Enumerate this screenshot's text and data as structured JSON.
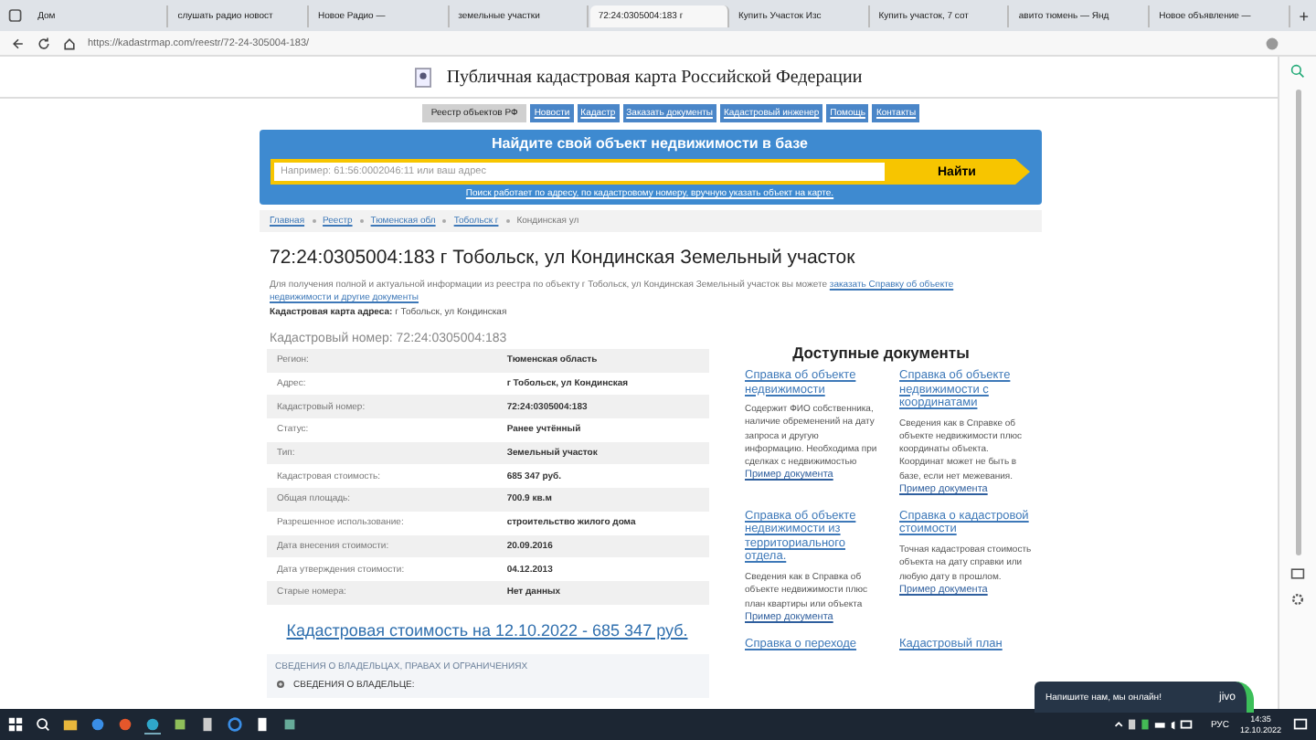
{
  "browser": {
    "tabs": [
      {
        "label": "Дом",
        "selected": false
      },
      {
        "label": "слушать радио новост",
        "selected": false
      },
      {
        "label": "Новое Радио —",
        "selected": false
      },
      {
        "label": "земельные участки",
        "selected": false
      },
      {
        "label": "72:24:0305004:183 г",
        "selected": true
      },
      {
        "label": "Купить Участок Изс",
        "selected": false
      },
      {
        "label": "Купить участок, 7 сот",
        "selected": false
      },
      {
        "label": "авито тюмень — Янд",
        "selected": false
      },
      {
        "label": "Новое объявление —",
        "selected": false
      }
    ],
    "new_tab": "+",
    "url": "https://kadastrmap.com/reestr/72-24-305004-183/"
  },
  "site": {
    "title": "Публичная кадастровая карта Российской Федерации",
    "nav": [
      {
        "label": "Реестр объектов РФ",
        "selected": true
      },
      {
        "label": "Новости",
        "selected": false
      },
      {
        "label": "Кадастр",
        "selected": false
      },
      {
        "label": "Заказать документы",
        "selected": false
      },
      {
        "label": "Кадастровый инженер",
        "selected": false
      },
      {
        "label": "Помощь",
        "selected": false
      },
      {
        "label": "Контакты",
        "selected": false
      }
    ]
  },
  "search": {
    "heading": "Найдите свой объект недвижимости в базе",
    "placeholder": "Например: 61:56:0002046:11 или ваш адрес",
    "button": "Найти",
    "hint": "Поиск работает по адресу, по кадастровому номеру, вручную указать объект на карте."
  },
  "breadcrumbs": [
    "Главная",
    "Реестр",
    "Тюменская обл",
    "Тобольск г",
    "Кондинская ул"
  ],
  "page": {
    "title": "72:24:0305004:183 г Тобольск, ул Кондинская Земельный участок",
    "intro": "Для получения полной и актуальной информации из реестра по объекту г Тобольск, ул Кондинская Земельный участок вы можете ",
    "intro_link": [
      "заказать Справку об объекте",
      "недвижимости и другие документы"
    ],
    "map_label": "Кадастровая карта адреса:",
    "map_value": " г Тобольск, ул Кондинская",
    "number_heading": "Кадастровый номер: 72:24:0305004:183"
  },
  "table": {
    "rows": [
      [
        "Регион:",
        "Тюменская область"
      ],
      [
        "Адрес:",
        "г Тобольск, ул Кондинская"
      ],
      [
        "Кадастровый номер:",
        "72:24:0305004:183"
      ],
      [
        "Статус:",
        "Ранее учтённый"
      ],
      [
        "Тип:",
        "Земельный участок"
      ],
      [
        "Кадастровая стоимость:",
        "685 347 руб."
      ],
      [
        "Общая площадь:",
        "700.9 кв.м"
      ],
      [
        "Разрешенное использование:",
        "строительство жилого дома"
      ],
      [
        "Дата внесения стоимости:",
        "20.09.2016"
      ],
      [
        "Дата утверждения стоимости:",
        "04.12.2013"
      ],
      [
        "Старые номера:",
        "Нет данных"
      ]
    ]
  },
  "cost_link": "Кадастровая стоимость на 12.10.2022 - 685 347 руб.",
  "owners": {
    "heading": "СВЕДЕНИЯ О ВЛАДЕЛЬЦАХ, ПРАВАХ И ОГРАНИЧЕНИЯХ",
    "item": "СВЕДЕНИЯ О ВЛАДЕЛЬЦЕ:"
  },
  "documents": {
    "heading": "Доступные документы",
    "items": [
      {
        "title": "Справка об объекте недвижимости",
        "text": "Содержит ФИО собственника, наличие обременений на дату запроса и другую информацию. Необходима при сделках с недвижимостью",
        "example": "Пример документа"
      },
      {
        "title": "Справка об объекте недвижимости с координатами",
        "text": "Сведения как в Справке об объекте недвижимости плюс координаты объекта. Координат может не быть в базе, если нет межевания.",
        "example": "Пример документа"
      },
      {
        "title": "Справка об объекте недвижимости из территориального отдела.",
        "text": "Сведения как в Справка об объекте недвижимости плюс план квартиры или объекта",
        "example": "Пример документа"
      },
      {
        "title": "Справка о кадастровой стоимости",
        "text": "Точная кадастровая стоимость объекта на дату справки или любую дату в прошлом.",
        "example": "Пример документа"
      },
      {
        "title": "Справка о переходе"
      },
      {
        "title": "Кадастровый план"
      }
    ]
  },
  "chat": {
    "text": "Напишите нам, мы онлайн!",
    "brand": "jivo"
  },
  "taskbar": {
    "lang": "РУС",
    "time": "14:35",
    "date": "12.10.2022"
  }
}
